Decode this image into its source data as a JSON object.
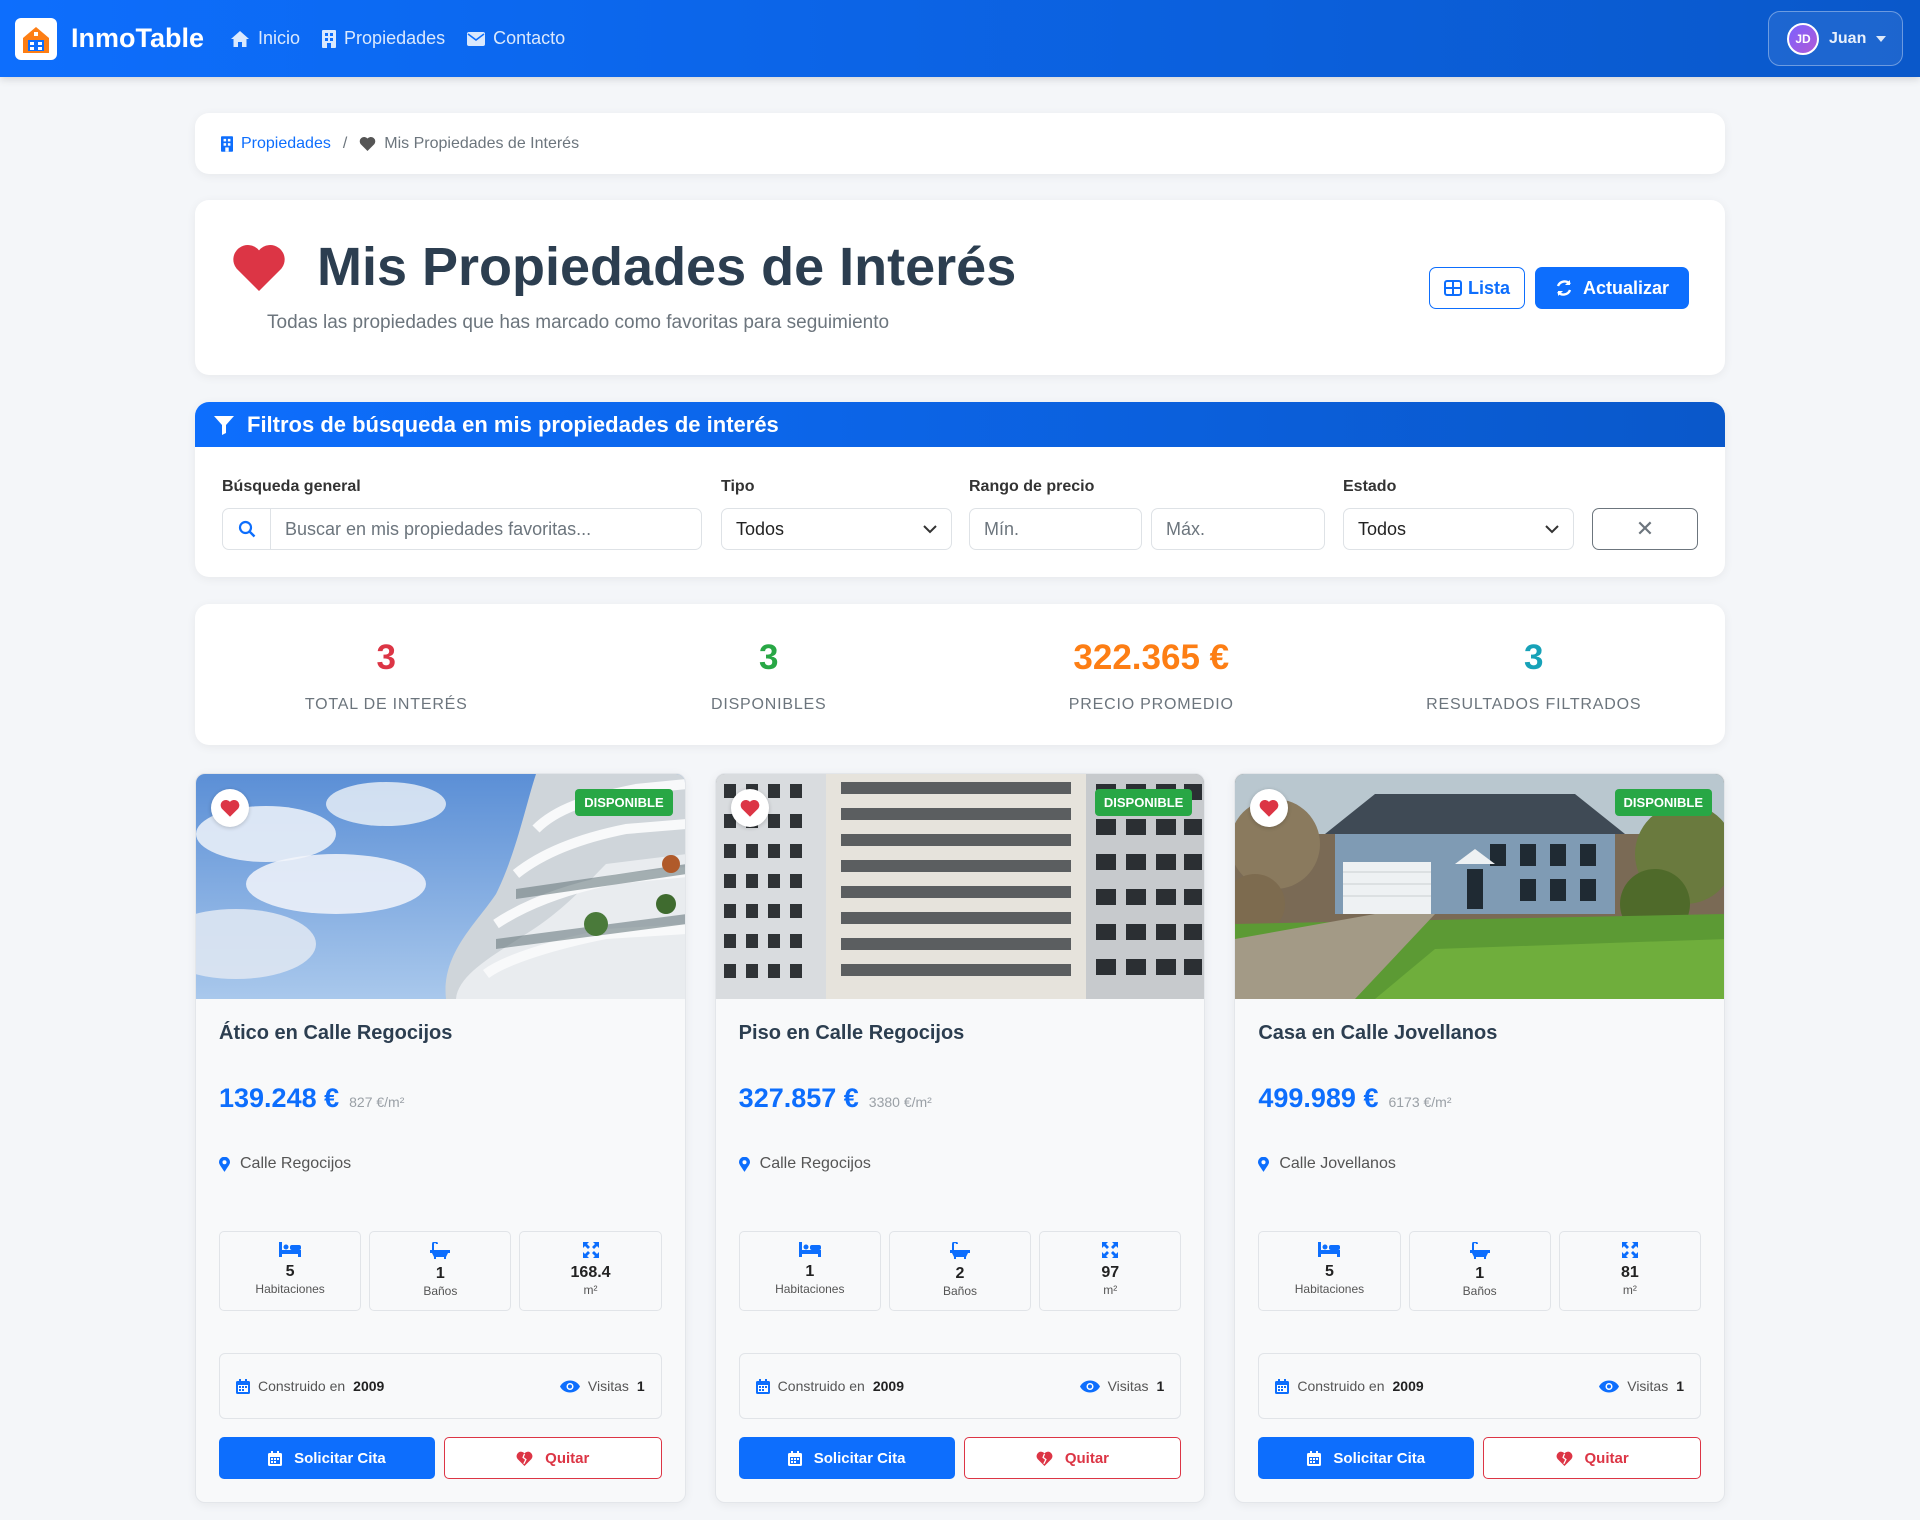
{
  "navbar": {
    "brand": "InmoTable",
    "links": [
      {
        "label": "Inicio",
        "icon": "home-icon"
      },
      {
        "label": "Propiedades",
        "icon": "building-icon"
      },
      {
        "label": "Contacto",
        "icon": "envelope-icon"
      }
    ],
    "user": {
      "initials": "JD",
      "name": "Juan"
    }
  },
  "breadcrumb": {
    "parent": "Propiedades",
    "separator": "/",
    "current": "Mis Propiedades de Interés"
  },
  "header": {
    "title": "Mis Propiedades de Interés",
    "subtitle": "Todas las propiedades que has marcado como favoritas para seguimiento",
    "view_button": "Lista",
    "refresh_button": "Actualizar"
  },
  "filters": {
    "title": "Filtros de búsqueda en mis propiedades de interés",
    "search_label": "Búsqueda general",
    "search_placeholder": "Buscar en mis propiedades favoritas...",
    "type_label": "Tipo",
    "type_value": "Todos",
    "price_label": "Rango de precio",
    "price_min_placeholder": "Mín.",
    "price_max_placeholder": "Máx.",
    "status_label": "Estado",
    "status_value": "Todos",
    "clear_label": "✕"
  },
  "stats": [
    {
      "value": "3",
      "label": "TOTAL DE INTERÉS",
      "color": "#dc3545"
    },
    {
      "value": "3",
      "label": "DISPONIBLES",
      "color": "#28a745"
    },
    {
      "value": "322.365 €",
      "label": "PRECIO PROMEDIO",
      "color": "#fd7e14"
    },
    {
      "value": "3",
      "label": "RESULTADOS FILTRADOS",
      "color": "#17a2b8"
    }
  ],
  "properties": [
    {
      "title": "Ático en Calle Regocijos",
      "price": "139.248 €",
      "price_m2": "827 €/m²",
      "address": "Calle Regocijos",
      "badge": "DISPONIBLE",
      "rooms": "5",
      "rooms_label": "Habitaciones",
      "baths": "1",
      "baths_label": "Baños",
      "area": "168.4",
      "area_label": "m²",
      "built_label": "Construido en",
      "built_year": "2009",
      "visits_label": "Visitas",
      "visits": "1",
      "cita_label": "Solicitar Cita",
      "quitar_label": "Quitar"
    },
    {
      "title": "Piso en Calle Regocijos",
      "price": "327.857 €",
      "price_m2": "3380 €/m²",
      "address": "Calle Regocijos",
      "badge": "DISPONIBLE",
      "rooms": "1",
      "rooms_label": "Habitaciones",
      "baths": "2",
      "baths_label": "Baños",
      "area": "97",
      "area_label": "m²",
      "built_label": "Construido en",
      "built_year": "2009",
      "visits_label": "Visitas",
      "visits": "1",
      "cita_label": "Solicitar Cita",
      "quitar_label": "Quitar"
    },
    {
      "title": "Casa en Calle Jovellanos",
      "price": "499.989 €",
      "price_m2": "6173 €/m²",
      "address": "Calle Jovellanos",
      "badge": "DISPONIBLE",
      "rooms": "5",
      "rooms_label": "Habitaciones",
      "baths": "1",
      "baths_label": "Baños",
      "area": "81",
      "area_label": "m²",
      "built_label": "Construido en",
      "built_year": "2009",
      "visits_label": "Visitas",
      "visits": "1",
      "cita_label": "Solicitar Cita",
      "quitar_label": "Quitar"
    }
  ]
}
